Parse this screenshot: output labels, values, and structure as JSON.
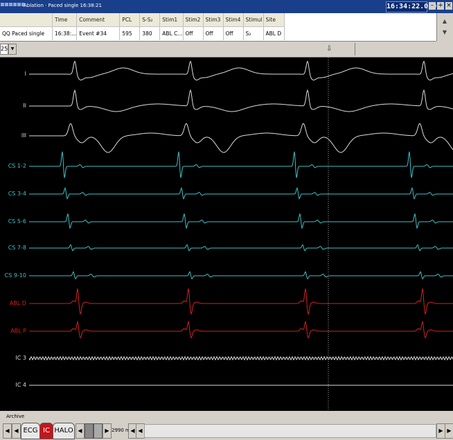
{
  "window": {
    "title": "Ablation · Paced single  16:38:21",
    "clock": "16:34:22.080",
    "buttons": {
      "minimize": "–",
      "maximize": "+",
      "close": "×"
    }
  },
  "info_table": {
    "headers": [
      "",
      "Time",
      "Comment",
      "PCL",
      "S-S₂",
      "Stim1",
      "Stim2",
      "Stim3",
      "Stim4",
      "Stimul",
      "Site"
    ],
    "row": [
      "QQ Paced single",
      "16:38:...",
      "Event #34",
      "595",
      "380",
      "ABL C...",
      "Off",
      "Off",
      "Off",
      "S₂",
      "ABL D"
    ]
  },
  "toolbar": {
    "speed_value": "25",
    "cursor_marker": "⇩"
  },
  "channels": [
    {
      "label": "I",
      "color": "#dddddd"
    },
    {
      "label": "II",
      "color": "#dddddd"
    },
    {
      "label": "III",
      "color": "#dddddd"
    },
    {
      "label": "CS 1-2",
      "color": "#3fc4c9"
    },
    {
      "label": "CS 3-4",
      "color": "#3fc4c9"
    },
    {
      "label": "CS 5-6",
      "color": "#3fc4c9"
    },
    {
      "label": "CS 7-8",
      "color": "#3fc4c9"
    },
    {
      "label": "CS 9-10",
      "color": "#3fc4c9"
    },
    {
      "label": "ABL D",
      "color": "#d52020"
    },
    {
      "label": "ABL P",
      "color": "#d52020"
    },
    {
      "label": "IC 3",
      "color": "#dddddd"
    },
    {
      "label": "IC 4",
      "color": "#dddddd"
    }
  ],
  "archive_label": "Archive",
  "bottom_bar": {
    "tabs": [
      "ECG",
      "IC",
      "HALO"
    ],
    "active_tab": "IC",
    "sweep": "2990 ms"
  }
}
